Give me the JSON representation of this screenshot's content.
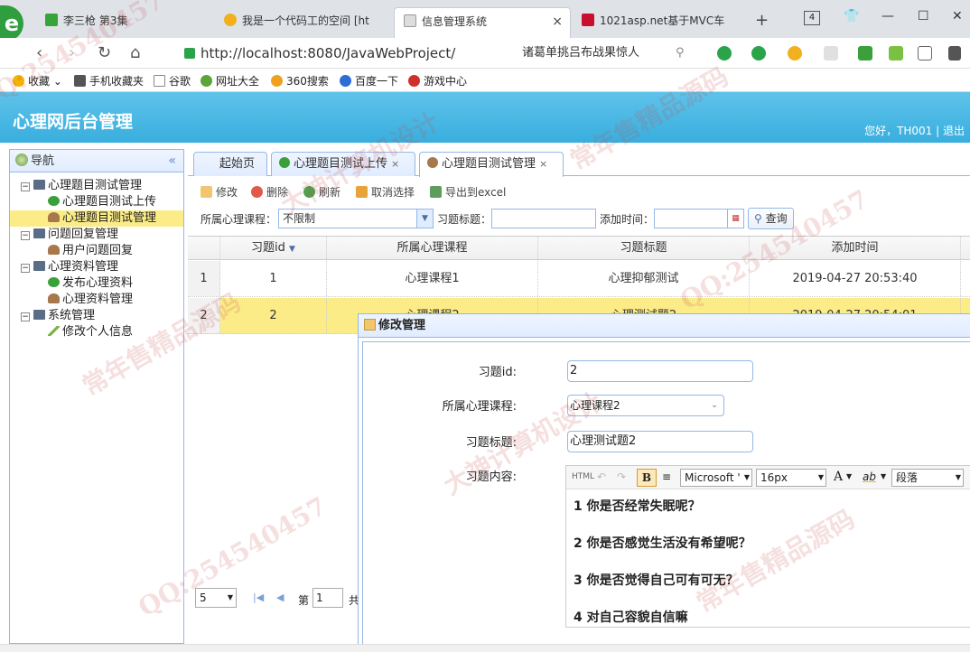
{
  "browser": {
    "logo": "e",
    "tabs": [
      {
        "title": "李三枪 第3集",
        "color": "#35a43a"
      },
      {
        "title": "我是一个代码工的空间 [ht",
        "color": "#f2b01e"
      },
      {
        "title": "信息管理系统",
        "color": "#bbbbbb"
      },
      {
        "title": "1021asp.net基于MVC车",
        "color": "#c8102e"
      }
    ],
    "tab_count": "4",
    "url": "http://localhost:8080/JavaWebProject/",
    "search_text": "诸葛单挑吕布战果惊人"
  },
  "bookmarks": [
    {
      "label": "收藏",
      "color": "#f5b400"
    },
    {
      "label": "手机收藏夹",
      "color": "#555555"
    },
    {
      "label": "谷歌",
      "color": "#888888"
    },
    {
      "label": "网址大全",
      "color": "#5aa53a"
    },
    {
      "label": "360搜索",
      "color": "#f0a020"
    },
    {
      "label": "百度一下",
      "color": "#2c6ed6"
    },
    {
      "label": "游戏中心",
      "color": "#d0302a"
    }
  ],
  "app": {
    "title": "心理网后台管理",
    "greeting": "您好，TH001 | 退出"
  },
  "nav": {
    "title": "导航",
    "collapse": "«",
    "items": [
      {
        "label": "心理题目测试管理",
        "level": 0,
        "icon": "monitor-icon"
      },
      {
        "label": "心理题目测试上传",
        "level": 1,
        "icon": "add-icon"
      },
      {
        "label": "心理题目测试管理",
        "level": 1,
        "icon": "user-icon",
        "selected": true
      },
      {
        "label": "问题回复管理",
        "level": 0,
        "icon": "monitor-icon"
      },
      {
        "label": "用户问题回复",
        "level": 1,
        "icon": "user-icon"
      },
      {
        "label": "心理资料管理",
        "level": 0,
        "icon": "monitor-icon"
      },
      {
        "label": "发布心理资料",
        "level": 1,
        "icon": "add-icon"
      },
      {
        "label": "心理资料管理",
        "level": 1,
        "icon": "user-icon"
      },
      {
        "label": "系统管理",
        "level": 0,
        "icon": "monitor-icon"
      },
      {
        "label": "修改个人信息",
        "level": 1,
        "icon": "pencil-icon"
      }
    ]
  },
  "center_tabs": [
    {
      "label": "起始页"
    },
    {
      "label": "心理题目测试上传",
      "close": "×"
    },
    {
      "label": "心理题目测试管理",
      "close": "×"
    }
  ],
  "toolbar": {
    "edit": "修改",
    "delete": "删除",
    "refresh": "刷新",
    "cancel_select": "取消选择",
    "export": "导出到excel"
  },
  "filters": {
    "course_label": "所属心理课程：",
    "course_value": "不限制",
    "title_label": "习题标题：",
    "date_label": "添加时间：",
    "query_label": "查询"
  },
  "grid": {
    "headers": [
      "习题id",
      "所属心理课程",
      "习题标题",
      "添加时间"
    ],
    "rows": [
      {
        "num": "1",
        "id": "1",
        "course": "心理课程1",
        "title": "心理抑郁测试",
        "time": "2019-04-27 20:53:40"
      },
      {
        "num": "2",
        "id": "2",
        "course": "心理课程2",
        "title": "心理测试题2",
        "time": "2019-04-27 20:54:01"
      }
    ]
  },
  "pager": {
    "size": "5",
    "page_prefix": "第",
    "page_value": "1",
    "total_prefix": "共"
  },
  "modal": {
    "title": "修改管理",
    "id_label": "习题id:",
    "id_value": "2",
    "course_label": "所属心理课程:",
    "course_value": "心理课程2",
    "title_label": "习题标题:",
    "title_value": "心理测试题2",
    "content_label": "习题内容:",
    "editor": {
      "html": "HTML",
      "bold": "B",
      "font": "Microsoft '",
      "size": "16px",
      "font_color": "A",
      "highlight": "ab",
      "paragraph": "段落",
      "lines": [
        "1 你是否经常失眠呢？",
        "2 你是否感觉生活没有希望呢？",
        "3 你是否觉得自己可有可无？",
        "4 对自己容貌自信嘛"
      ]
    }
  },
  "watermarks": [
    "QQ:254540457",
    "常年售精品源码",
    "大神计算机设计",
    "QQ:254540457",
    "常年售精品源码",
    "大神计算机设计",
    "QQ:254540457",
    "常年售精品源码"
  ]
}
